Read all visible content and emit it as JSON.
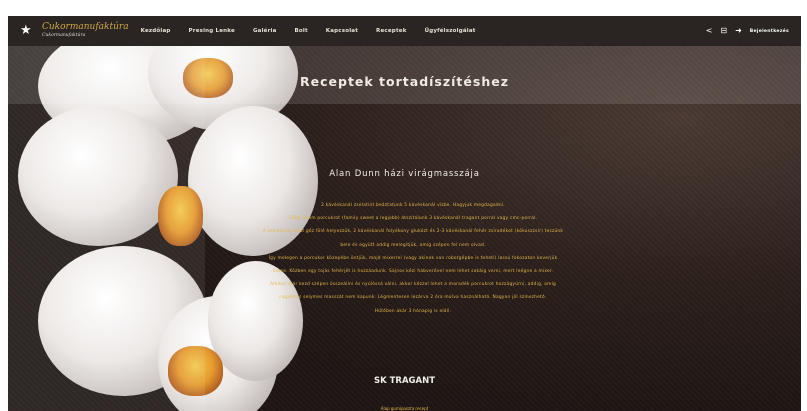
{
  "nav": {
    "brand_title": "Cukormanufaktúra",
    "brand_subtitle": "Cukormanufaktúra",
    "menu": [
      "Kezdőlap",
      "Presing Lenke",
      "Galéria",
      "Bolt",
      "Kapcsolat",
      "Receptek",
      "Ügyfélszolgálat"
    ],
    "login_label": "Bejelentkezés"
  },
  "page": {
    "title": "Receptek tortadíszítéshez",
    "recipe1_title": "Alan Dunn házi virágmasszája",
    "recipe1_lines": [
      "2 kávéskanál zselatint beáztatunk 5 kávéskanál vízbe. Hagyjuk megdagadni.",
      "500g finom porcukrot (family sweet a legjobb) átszitálunk 3 kávéskanál tragant porral vagy cmc-porral.",
      "A zselatinos tálat gőz fölé helyezzük, 2 kávéskanál folyékony glukózt és 2-3 kávéskanál fehér zsiradékot (kókuszzsír) teszünk",
      "bele és együtt addig melegítjük, amíg szépen fel nem olvad.",
      "Így melegen a porcukor közepébe öntjük, majd mixerrel (vagy akinek van robotgépbe is teheti) lassú fokozaton keverjük",
      "össze. Közben egy tojás fehérjét is hozzáadunk. Sajnos kézi habverővel nem lehet sokáig verni, mert leégne a mixer.",
      "Amikor már kezd szépen összeállni és nyúlóssá válni, akkor kézzel lehet a maradék porcukrot hozzágyúrni, addig, amíg",
      "rugalmas selymes masszát nem kapunk. Légmentesen lezárva 2 óra múlva használható. Nagyon jól színezhető.",
      "Hűtőben akár 3 hónapig is eláll."
    ],
    "recipe2_title": "SK TRAGANT",
    "recipe2_sub": "Alap gumipaszta recept"
  }
}
